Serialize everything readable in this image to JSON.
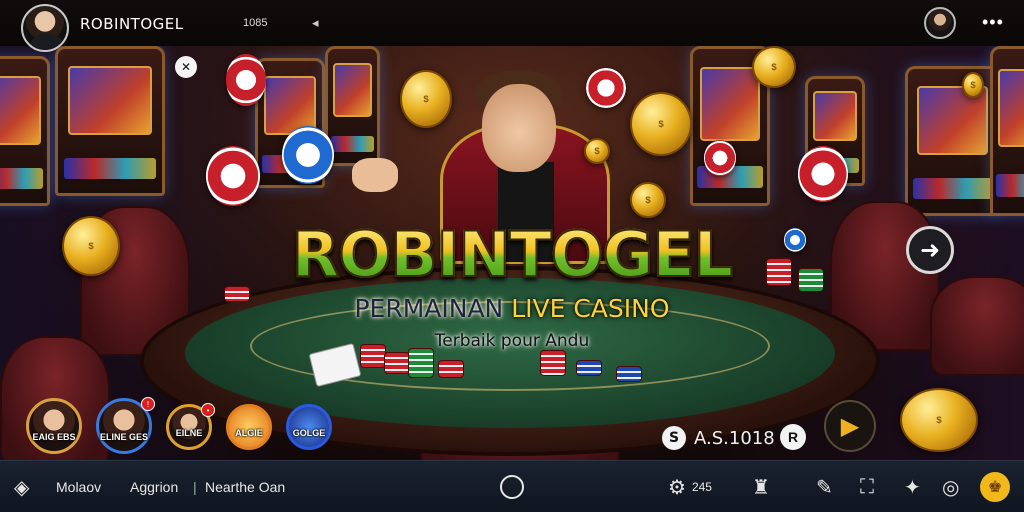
{
  "header": {
    "app_title": "ROBINTOGEL",
    "stat": "1085",
    "cursor_glyph": "◂",
    "menu_glyph": "•••"
  },
  "hero": {
    "brand": "ROBINTOGEL",
    "tagline_prefix": "PERMAINAN ",
    "tagline_highlight": "LIVE CASINO",
    "subtagline": "Terbaik pour Andu",
    "badge_glyph": "✕",
    "next_glyph": "➜"
  },
  "players": [
    {
      "name": "EAIG EBS",
      "notif": ""
    },
    {
      "name": "ELINE GES",
      "notif": "!"
    },
    {
      "name": "EILNE",
      "notif": "•"
    },
    {
      "name": "ALGIE",
      "notif": ""
    },
    {
      "name": "GOLGE",
      "notif": ""
    }
  ],
  "balance": {
    "symbol": "S",
    "value": "A.S.1018",
    "action_glyph": "R",
    "play_glyph": "▶"
  },
  "bottom_nav": {
    "left_icon": "◈",
    "item1": "Molaov",
    "item2": "Aggrion",
    "separator": "|",
    "item3": "Nearthe Oan",
    "settings_glyph": "⚙",
    "settings_value": "245",
    "icon_trophy": "♜",
    "icon_edit": "✎",
    "icon_expand": "⛶",
    "icon_leaf": "✦",
    "icon_compass": "◎",
    "profile_glyph": "♚"
  },
  "colors": {
    "accent_gold": "#f0c020",
    "accent_green": "#6fbf2a",
    "bottom_bar": "#101620"
  }
}
